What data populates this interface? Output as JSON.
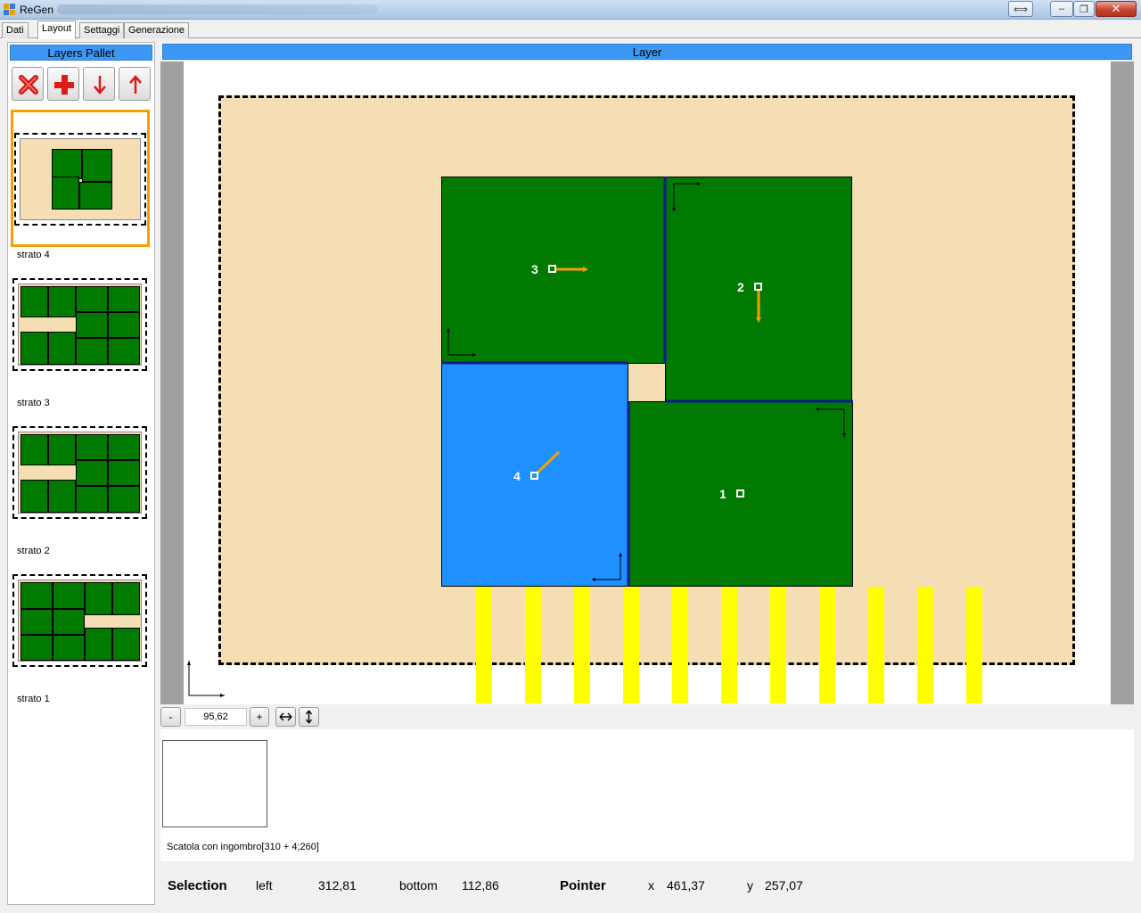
{
  "window": {
    "title": "ReGen",
    "controls": {
      "extra": "⟺",
      "minimize": "–",
      "maximize": "❐",
      "close": "✕"
    }
  },
  "tabs": [
    {
      "label": "Dati",
      "active": false
    },
    {
      "label": "Layout",
      "active": true
    },
    {
      "label": "Settaggi",
      "active": false
    },
    {
      "label": "Generazione",
      "active": false
    }
  ],
  "layers_panel": {
    "header": "Layers Pallet",
    "tools": [
      {
        "name": "delete",
        "icon": "red-x-icon"
      },
      {
        "name": "add",
        "icon": "red-plus-icon"
      },
      {
        "name": "move-down",
        "icon": "red-arrow-down-icon"
      },
      {
        "name": "move-up",
        "icon": "red-arrow-up-icon"
      }
    ],
    "layers": [
      {
        "label": "strato 4",
        "selected": true
      },
      {
        "label": "strato 3",
        "selected": false
      },
      {
        "label": "strato 2",
        "selected": false
      },
      {
        "label": "strato 1",
        "selected": false
      }
    ]
  },
  "layer_view": {
    "header": "Layer",
    "colors": {
      "pallet": "#f5deb3",
      "box": "#007a00",
      "selected_box": "#1e90ff",
      "slat": "#ffff00",
      "arrow": "#f5a000"
    },
    "boxes": [
      {
        "label": "1",
        "selected": false
      },
      {
        "label": "2",
        "selected": false
      },
      {
        "label": "3",
        "selected": false
      },
      {
        "label": "4",
        "selected": true
      }
    ]
  },
  "zoom": {
    "minus_label": "-",
    "value": "95,62",
    "plus_label": "+",
    "fit_width_icon": "horizontal-arrows-icon",
    "fit_height_icon": "vertical-arrows-icon"
  },
  "info": {
    "box_description": "Scatola con ingombro[310 + 4;260]"
  },
  "status": {
    "selection_label": "Selection",
    "left_label": "left",
    "left_value": "312,81",
    "bottom_label": "bottom",
    "bottom_value": "112,86",
    "pointer_label": "Pointer",
    "x_label": "x",
    "x_value": "461,37",
    "y_label": "y",
    "y_value": "257,07"
  }
}
